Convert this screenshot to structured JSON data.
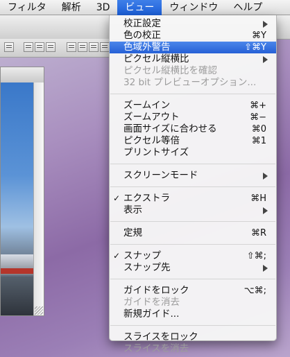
{
  "menubar": {
    "items": [
      {
        "label": "フィルタ"
      },
      {
        "label": "解析"
      },
      {
        "label": "3D"
      },
      {
        "label": "ビュー"
      },
      {
        "label": "ウィンドウ"
      },
      {
        "label": "ヘルプ"
      }
    ]
  },
  "menu": {
    "g1": [
      {
        "label": "校正設定",
        "submenu": true
      },
      {
        "label": "色の校正",
        "shortcut": "⌘Y"
      },
      {
        "label": "色域外警告",
        "shortcut": "⇧⌘Y",
        "highlighted": true
      },
      {
        "label": "ピクセル縦横比",
        "submenu": true
      },
      {
        "label": "ピクセル縦横比を確認",
        "disabled": true
      },
      {
        "label": "32 bit プレビューオプション...",
        "disabled": true
      }
    ],
    "g2": [
      {
        "label": "ズームイン",
        "shortcut": "⌘+"
      },
      {
        "label": "ズームアウト",
        "shortcut": "⌘−"
      },
      {
        "label": "画面サイズに合わせる",
        "shortcut": "⌘0"
      },
      {
        "label": "ピクセル等倍",
        "shortcut": "⌘1"
      },
      {
        "label": "プリントサイズ"
      }
    ],
    "g3": [
      {
        "label": "スクリーンモード",
        "submenu": true
      }
    ],
    "g4": [
      {
        "label": "エクストラ",
        "shortcut": "⌘H",
        "checked": true
      },
      {
        "label": "表示",
        "submenu": true
      }
    ],
    "g5": [
      {
        "label": "定規",
        "shortcut": "⌘R"
      }
    ],
    "g6": [
      {
        "label": "スナップ",
        "shortcut": "⇧⌘;",
        "checked": true
      },
      {
        "label": "スナップ先",
        "submenu": true
      }
    ],
    "g7": [
      {
        "label": "ガイドをロック",
        "shortcut": "⌥⌘;"
      },
      {
        "label": "ガイドを消去",
        "disabled": true
      },
      {
        "label": "新規ガイド..."
      }
    ],
    "g8": [
      {
        "label": "スライスをロック"
      },
      {
        "label": "スライスを消去",
        "disabled": true
      }
    ],
    "check_mark": "✓"
  },
  "colors": {
    "highlight": "#2f6bdf",
    "menubar_active": "#2a68dc",
    "disabled_text": "#9c9c9c"
  }
}
